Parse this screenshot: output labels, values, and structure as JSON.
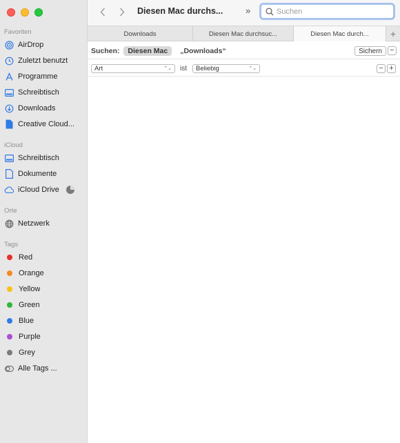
{
  "sidebar": {
    "favorites_header": "Favoriten",
    "favorites": [
      {
        "label": "AirDrop",
        "icon": "airdrop-icon"
      },
      {
        "label": "Zuletzt benutzt",
        "icon": "clock-icon"
      },
      {
        "label": "Programme",
        "icon": "applications-icon"
      },
      {
        "label": "Schreibtisch",
        "icon": "desktop-icon"
      },
      {
        "label": "Downloads",
        "icon": "download-icon"
      },
      {
        "label": "Creative Cloud...",
        "icon": "document-icon"
      }
    ],
    "icloud_header": "iCloud",
    "icloud": [
      {
        "label": "Schreibtisch",
        "icon": "desktop-icon"
      },
      {
        "label": "Dokumente",
        "icon": "document-icon"
      },
      {
        "label": "iCloud Drive",
        "icon": "cloud-icon"
      }
    ],
    "locations_header": "Orte",
    "locations": [
      {
        "label": "Netzwerk",
        "icon": "network-icon"
      }
    ],
    "tags_header": "Tags",
    "tags": [
      {
        "label": "Red",
        "color": "#e5312c"
      },
      {
        "label": "Orange",
        "color": "#f68a1e"
      },
      {
        "label": "Yellow",
        "color": "#f5c317"
      },
      {
        "label": "Green",
        "color": "#2fb83b"
      },
      {
        "label": "Blue",
        "color": "#2f7be5"
      },
      {
        "label": "Purple",
        "color": "#a74fd8"
      },
      {
        "label": "Grey",
        "color": "#7b7b7b"
      }
    ],
    "all_tags": "Alle Tags ..."
  },
  "toolbar": {
    "title": "Diesen Mac durchs...",
    "more": "»",
    "search_placeholder": "Suchen",
    "search_value": ""
  },
  "tabs": [
    {
      "label": "Downloads",
      "active": false
    },
    {
      "label": "Diesen Mac durchsuc...",
      "active": false
    },
    {
      "label": "Diesen Mac durch...",
      "active": true
    }
  ],
  "scope": {
    "label": "Suchen:",
    "selected": "Diesen Mac",
    "alternative": "„Downloads“",
    "save_label": "Sichern"
  },
  "criteria": {
    "attribute": "Art",
    "operator": "ist",
    "value": "Beliebig"
  }
}
